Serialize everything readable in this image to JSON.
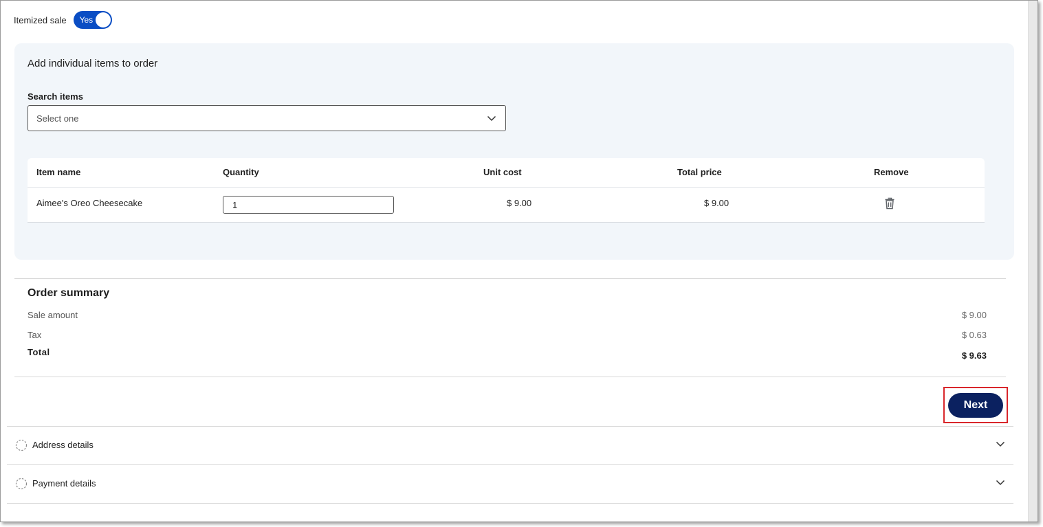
{
  "itemized": {
    "label": "Itemized sale",
    "toggle_text": "Yes"
  },
  "items_panel": {
    "heading": "Add individual items to order",
    "search": {
      "label": "Search items",
      "placeholder": "Select one",
      "icon": "chevron-down-icon"
    },
    "table": {
      "headers": {
        "name": "Item name",
        "quantity": "Quantity",
        "unit_cost": "Unit cost",
        "total_price": "Total price",
        "remove": "Remove"
      },
      "rows": [
        {
          "name": "Aimee's Oreo Cheesecake",
          "quantity": "1",
          "unit_cost": "$ 9.00",
          "total_price": "$ 9.00",
          "remove_icon": "trash-icon"
        }
      ]
    }
  },
  "summary": {
    "title": "Order summary",
    "sale_amount_label": "Sale amount",
    "sale_amount_value": "$ 9.00",
    "tax_label": "Tax",
    "tax_value": "$ 0.63",
    "total_label": "Total",
    "total_value": "$ 9.63"
  },
  "next_button": {
    "label": "Next",
    "color": "#0b2160",
    "highlight_color": "#d9262b"
  },
  "accordion": [
    {
      "label": "Address details",
      "status_icon": "dashed-circle-icon",
      "expand_icon": "chevron-down-icon"
    },
    {
      "label": "Payment details",
      "status_icon": "dashed-circle-icon",
      "expand_icon": "chevron-down-icon"
    }
  ],
  "colors": {
    "toggle_on": "#0a4dc4",
    "panel_bg": "#f2f6fa"
  }
}
